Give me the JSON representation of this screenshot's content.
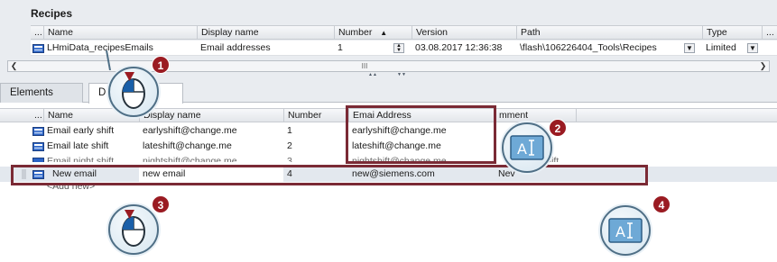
{
  "recipes_panel": {
    "title": "Recipes",
    "columns": [
      "...",
      "Name",
      "Display name",
      "Number",
      "Version",
      "Path",
      "Type",
      "..."
    ],
    "rows": [
      {
        "name": "LHmiData_recipesEmails",
        "display_name": "Email addresses",
        "number": "1",
        "version": "03.08.2017 12:36:38",
        "path": "\\flash\\106226404_Tools\\Recipes",
        "type": "Limited"
      }
    ],
    "scroll_thumb": "III"
  },
  "tabs": {
    "elements": "Elements",
    "data": "D"
  },
  "elements_table": {
    "columns": [
      "...",
      "Name",
      "Display name",
      "Number",
      "Emai Address",
      "mment"
    ],
    "rows": [
      {
        "name": "Email early shift",
        "display_name": "earlyshift@change.me",
        "number": "1",
        "email": "earlyshift@change.me",
        "comment": ""
      },
      {
        "name": "Email late shift",
        "display_name": "lateshift@change.me",
        "number": "2",
        "email": "lateshift@change.me",
        "comment": ""
      },
      {
        "name": "Email night shift",
        "display_name": "nightshift@change.me",
        "number": "3",
        "email": "nightshift@change.me",
        "comment": "shift"
      },
      {
        "name": "New email",
        "display_name": "new email",
        "number": "4",
        "email": "new@siemens.com",
        "comment": "Nev"
      }
    ],
    "add_new": "<Add new>"
  },
  "callouts": {
    "c1": "1",
    "c2": "2",
    "c3": "3",
    "c4": "4"
  },
  "colors": {
    "highlight": "#7a2a35",
    "badge": "#9a1b22",
    "icon": "#2b63c6"
  }
}
